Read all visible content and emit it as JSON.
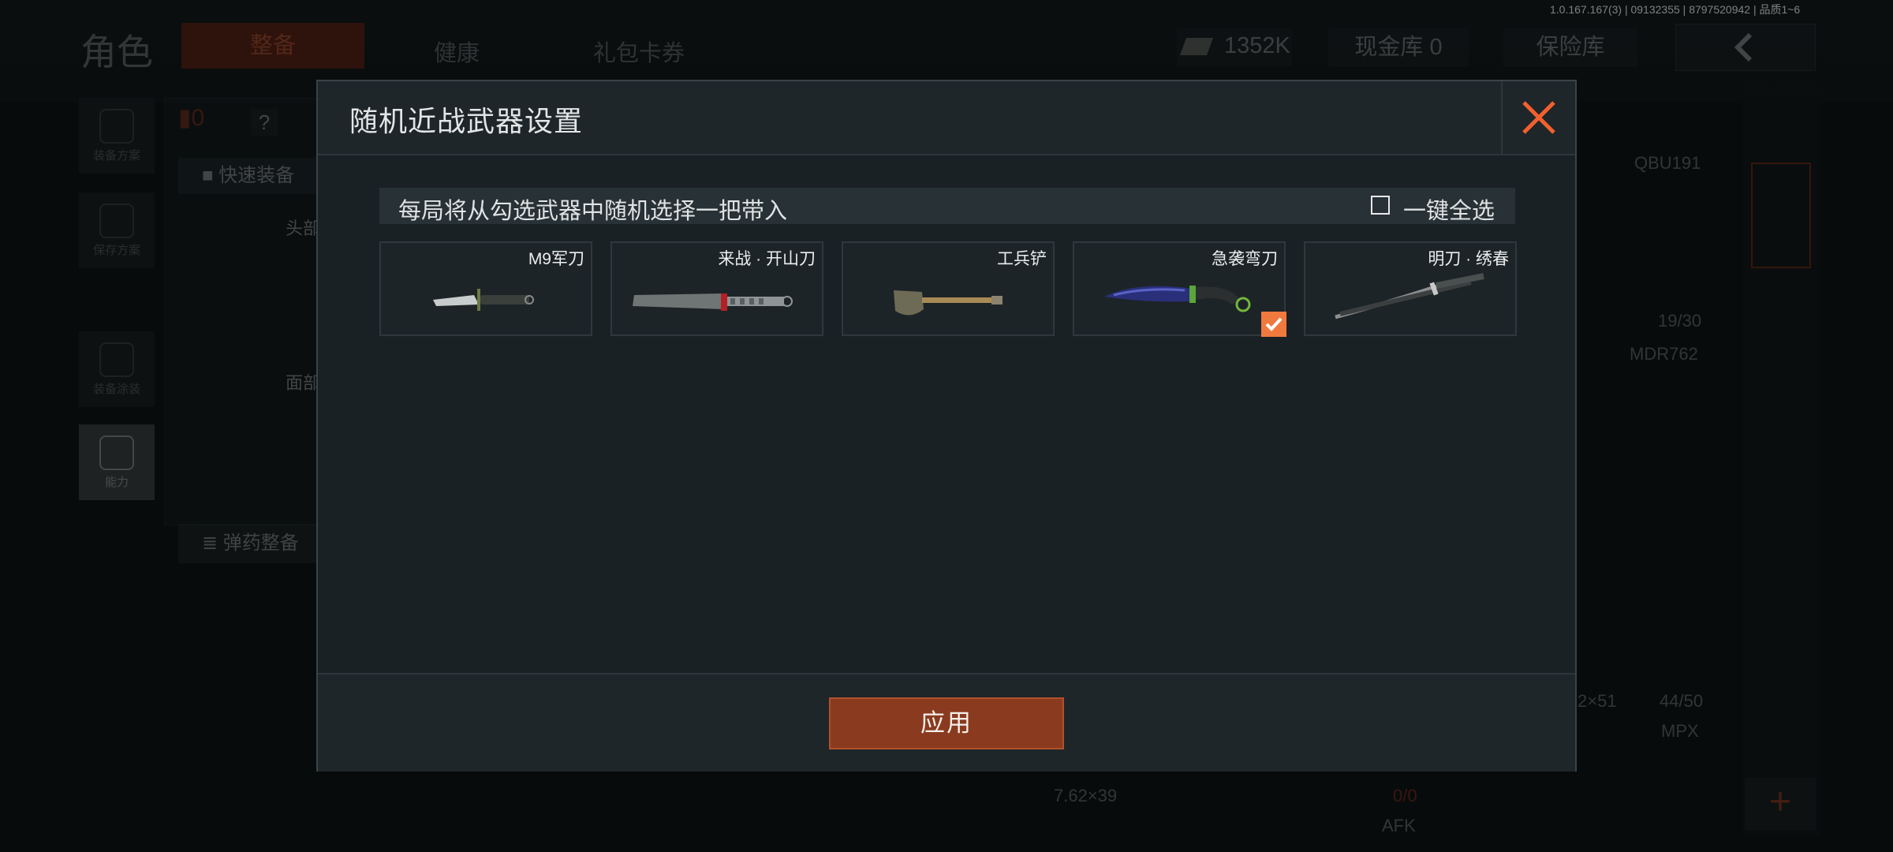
{
  "version": "1.0.167.167(3) | 09132355 | 8797520942 | 品质1~6",
  "background": {
    "title": "角色",
    "tabs": [
      "整备",
      "健康",
      "礼包卡券"
    ],
    "currency": "1352K",
    "cash_vault": "现金库 0",
    "safe_vault": "保险库",
    "side_buttons": [
      "装备方案",
      "保存方案",
      "装备涂装",
      "能力"
    ],
    "quick_equip": "快速装备",
    "ammo_equip": "弹药整备",
    "armor_count": "0",
    "help": "?",
    "slot_head": "头部",
    "slot_face": "面部",
    "weapon1_name": "QBU191",
    "weapon1_ammo": "19/30",
    "weapon2_name": "MDR762",
    "weapon3_caliber": "2×51",
    "weapon3_ammo": "44/50",
    "weapon3_name": "MPX",
    "ammo_caliber": "7.62×39",
    "ammo_count": "0/0",
    "ammo_extra": "AFK",
    "add": "+"
  },
  "modal": {
    "title": "随机近战武器设置",
    "instruction": "每局将从勾选武器中随机选择一把带入",
    "select_all": "一键全选",
    "select_all_checked": false,
    "weapons": [
      {
        "name": "M9军刀",
        "icon": "bayonet-icon",
        "checked": false
      },
      {
        "name": "来战 · 开山刀",
        "icon": "machete-icon",
        "checked": false
      },
      {
        "name": "工兵铲",
        "icon": "shovel-icon",
        "checked": false
      },
      {
        "name": "急袭弯刀",
        "icon": "karambit-icon",
        "checked": true
      },
      {
        "name": "明刀 · 绣春",
        "icon": "sword-icon",
        "checked": false
      }
    ],
    "apply_label": "应用"
  },
  "colors": {
    "accent": "#f07a3e",
    "apply_bg": "#8a3a1f",
    "close": "#f2602e"
  }
}
